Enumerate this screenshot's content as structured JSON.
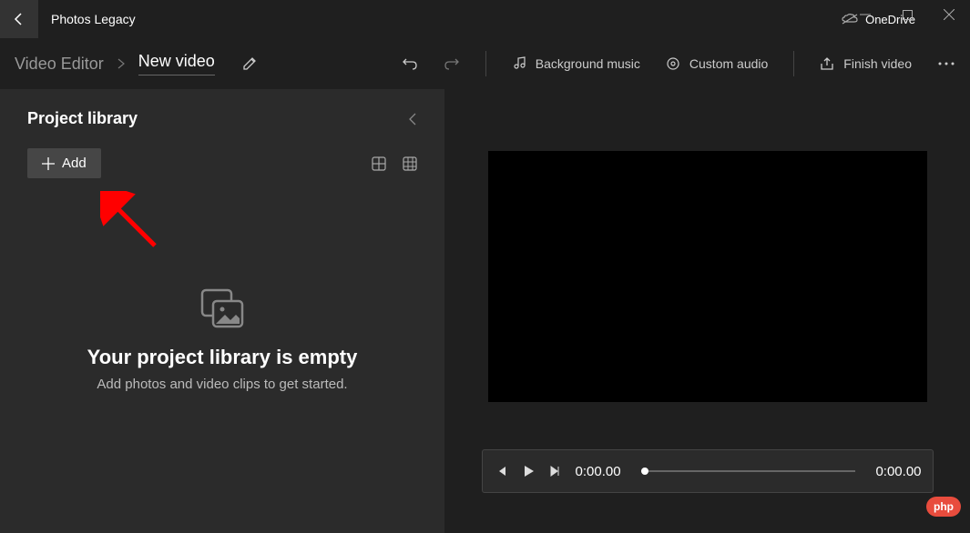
{
  "app": {
    "title": "Photos Legacy"
  },
  "titlebar": {
    "onedrive_label": "OneDrive"
  },
  "breadcrumb": {
    "parent": "Video Editor",
    "current": "New video"
  },
  "header_actions": {
    "undo": "Undo",
    "redo": "Redo",
    "bg_music": "Background music",
    "custom_audio": "Custom audio",
    "finish": "Finish video"
  },
  "sidebar": {
    "title": "Project library",
    "add_label": "Add",
    "empty_title": "Your project library is empty",
    "empty_subtitle": "Add photos and video clips to get started."
  },
  "player": {
    "current_time": "0:00.00",
    "total_time": "0:00.00"
  },
  "badge": {
    "php": "php"
  }
}
